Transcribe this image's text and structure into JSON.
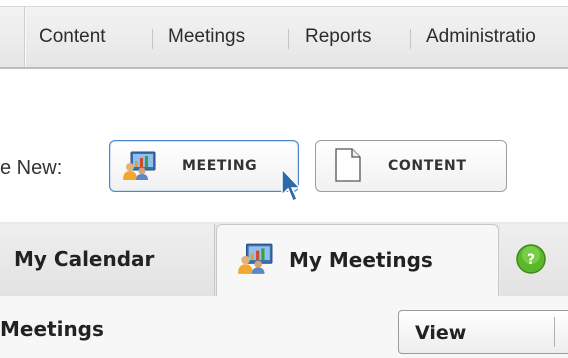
{
  "topnav": {
    "items": [
      {
        "label": "Content"
      },
      {
        "label": "Meetings"
      },
      {
        "label": "Reports"
      },
      {
        "label": "Administratio"
      }
    ]
  },
  "create": {
    "label": "e New:",
    "meeting_label": "MEETING",
    "content_label": "CONTENT"
  },
  "tabs": [
    {
      "label": "My Calendar",
      "icon": "calendar"
    },
    {
      "label": "My Meetings",
      "icon": "meeting-icon"
    },
    {
      "label": "",
      "icon": "help-icon"
    }
  ],
  "section": {
    "title": "Meetings",
    "view_label": "View"
  },
  "colors": {
    "accent_border": "#4f86c9",
    "help_green": "#5cb82b",
    "cursor_blue": "#2e69a8"
  }
}
